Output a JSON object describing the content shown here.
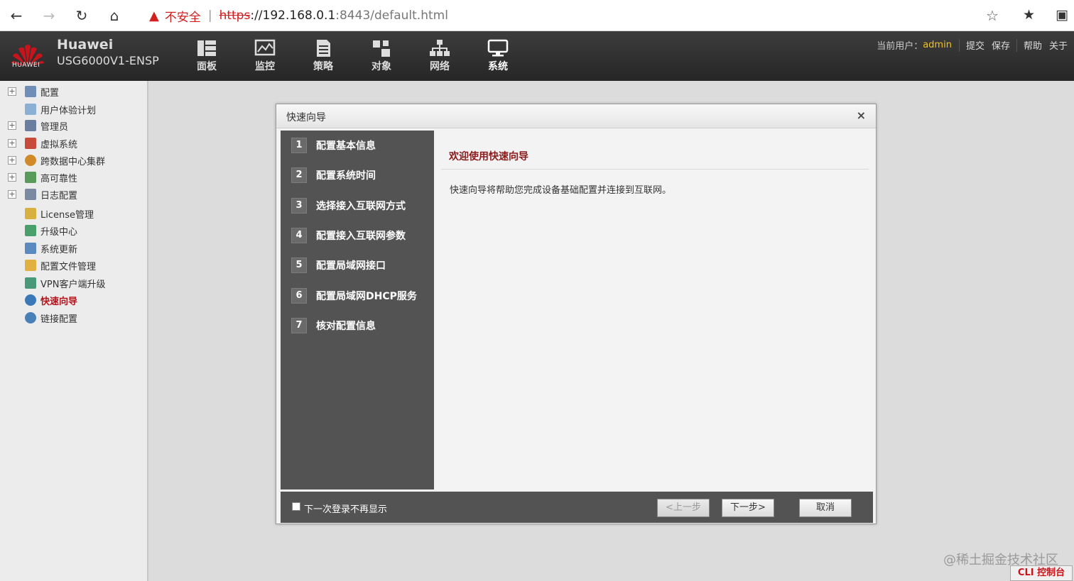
{
  "browser": {
    "security_text": "不安全",
    "url_scheme": "https",
    "url_host": "://192.168.0.1",
    "url_rest": ":8443/default.html"
  },
  "header": {
    "brand_name": "Huawei",
    "brand_model": "USG6000V1-ENSP",
    "logo_text": "HUAWEI",
    "nav": [
      {
        "label": "面板",
        "icon": "dashboard-icon"
      },
      {
        "label": "监控",
        "icon": "monitor-icon"
      },
      {
        "label": "策略",
        "icon": "policy-icon"
      },
      {
        "label": "对象",
        "icon": "object-icon"
      },
      {
        "label": "网络",
        "icon": "network-icon"
      },
      {
        "label": "系统",
        "icon": "system-icon"
      }
    ],
    "user_label": "当前用户：",
    "user_name": "admin",
    "submit_label": "提交",
    "save_label": "保存",
    "help_label": "帮助",
    "about_label": "关于"
  },
  "sidebar": {
    "items": [
      {
        "label": "配置",
        "expandable": true,
        "icon": "config-icon"
      },
      {
        "label": "用户体验计划",
        "expandable": false,
        "icon": "user-experience-icon"
      },
      {
        "label": "管理员",
        "expandable": true,
        "icon": "admin-icon"
      },
      {
        "label": "虚拟系统",
        "expandable": true,
        "icon": "virtual-system-icon"
      },
      {
        "label": "跨数据中心集群",
        "expandable": true,
        "icon": "cluster-icon"
      },
      {
        "label": "高可靠性",
        "expandable": true,
        "icon": "high-availability-icon"
      },
      {
        "label": "日志配置",
        "expandable": true,
        "icon": "log-icon"
      },
      {
        "label": "License管理",
        "expandable": false,
        "icon": "license-icon"
      },
      {
        "label": "升级中心",
        "expandable": false,
        "icon": "upgrade-icon"
      },
      {
        "label": "系统更新",
        "expandable": false,
        "icon": "update-icon"
      },
      {
        "label": "配置文件管理",
        "expandable": false,
        "icon": "config-file-icon"
      },
      {
        "label": "VPN客户端升级",
        "expandable": false,
        "icon": "vpn-icon"
      },
      {
        "label": "快速向导",
        "expandable": false,
        "icon": "wizard-icon",
        "active": true
      },
      {
        "label": "链接配置",
        "expandable": false,
        "icon": "link-config-icon"
      }
    ]
  },
  "dialog": {
    "title": "快速向导",
    "close_symbol": "×",
    "steps": [
      {
        "num": "1",
        "label": "配置基本信息"
      },
      {
        "num": "2",
        "label": "配置系统时间"
      },
      {
        "num": "3",
        "label": "选择接入互联网方式"
      },
      {
        "num": "4",
        "label": "配置接入互联网参数"
      },
      {
        "num": "5",
        "label": "配置局域网接口"
      },
      {
        "num": "6",
        "label": "配置局域网DHCP服务"
      },
      {
        "num": "7",
        "label": "核对配置信息"
      }
    ],
    "content_title": "欢迎使用快速向导",
    "content_desc": "快速向导将帮助您完成设备基础配置并连接到互联网。",
    "checkbox_label": "下一次登录不再显示",
    "prev_label": "<上一步",
    "next_label": "下一步>",
    "cancel_label": "取消"
  },
  "watermark": "@稀土掘金技术社区",
  "cli_label": "CLI 控制台",
  "colors": {
    "brand_red": "#c8141b",
    "header_bg": "#2e2e2e",
    "step_panel": "#535353",
    "user_highlight": "#f3c316"
  }
}
